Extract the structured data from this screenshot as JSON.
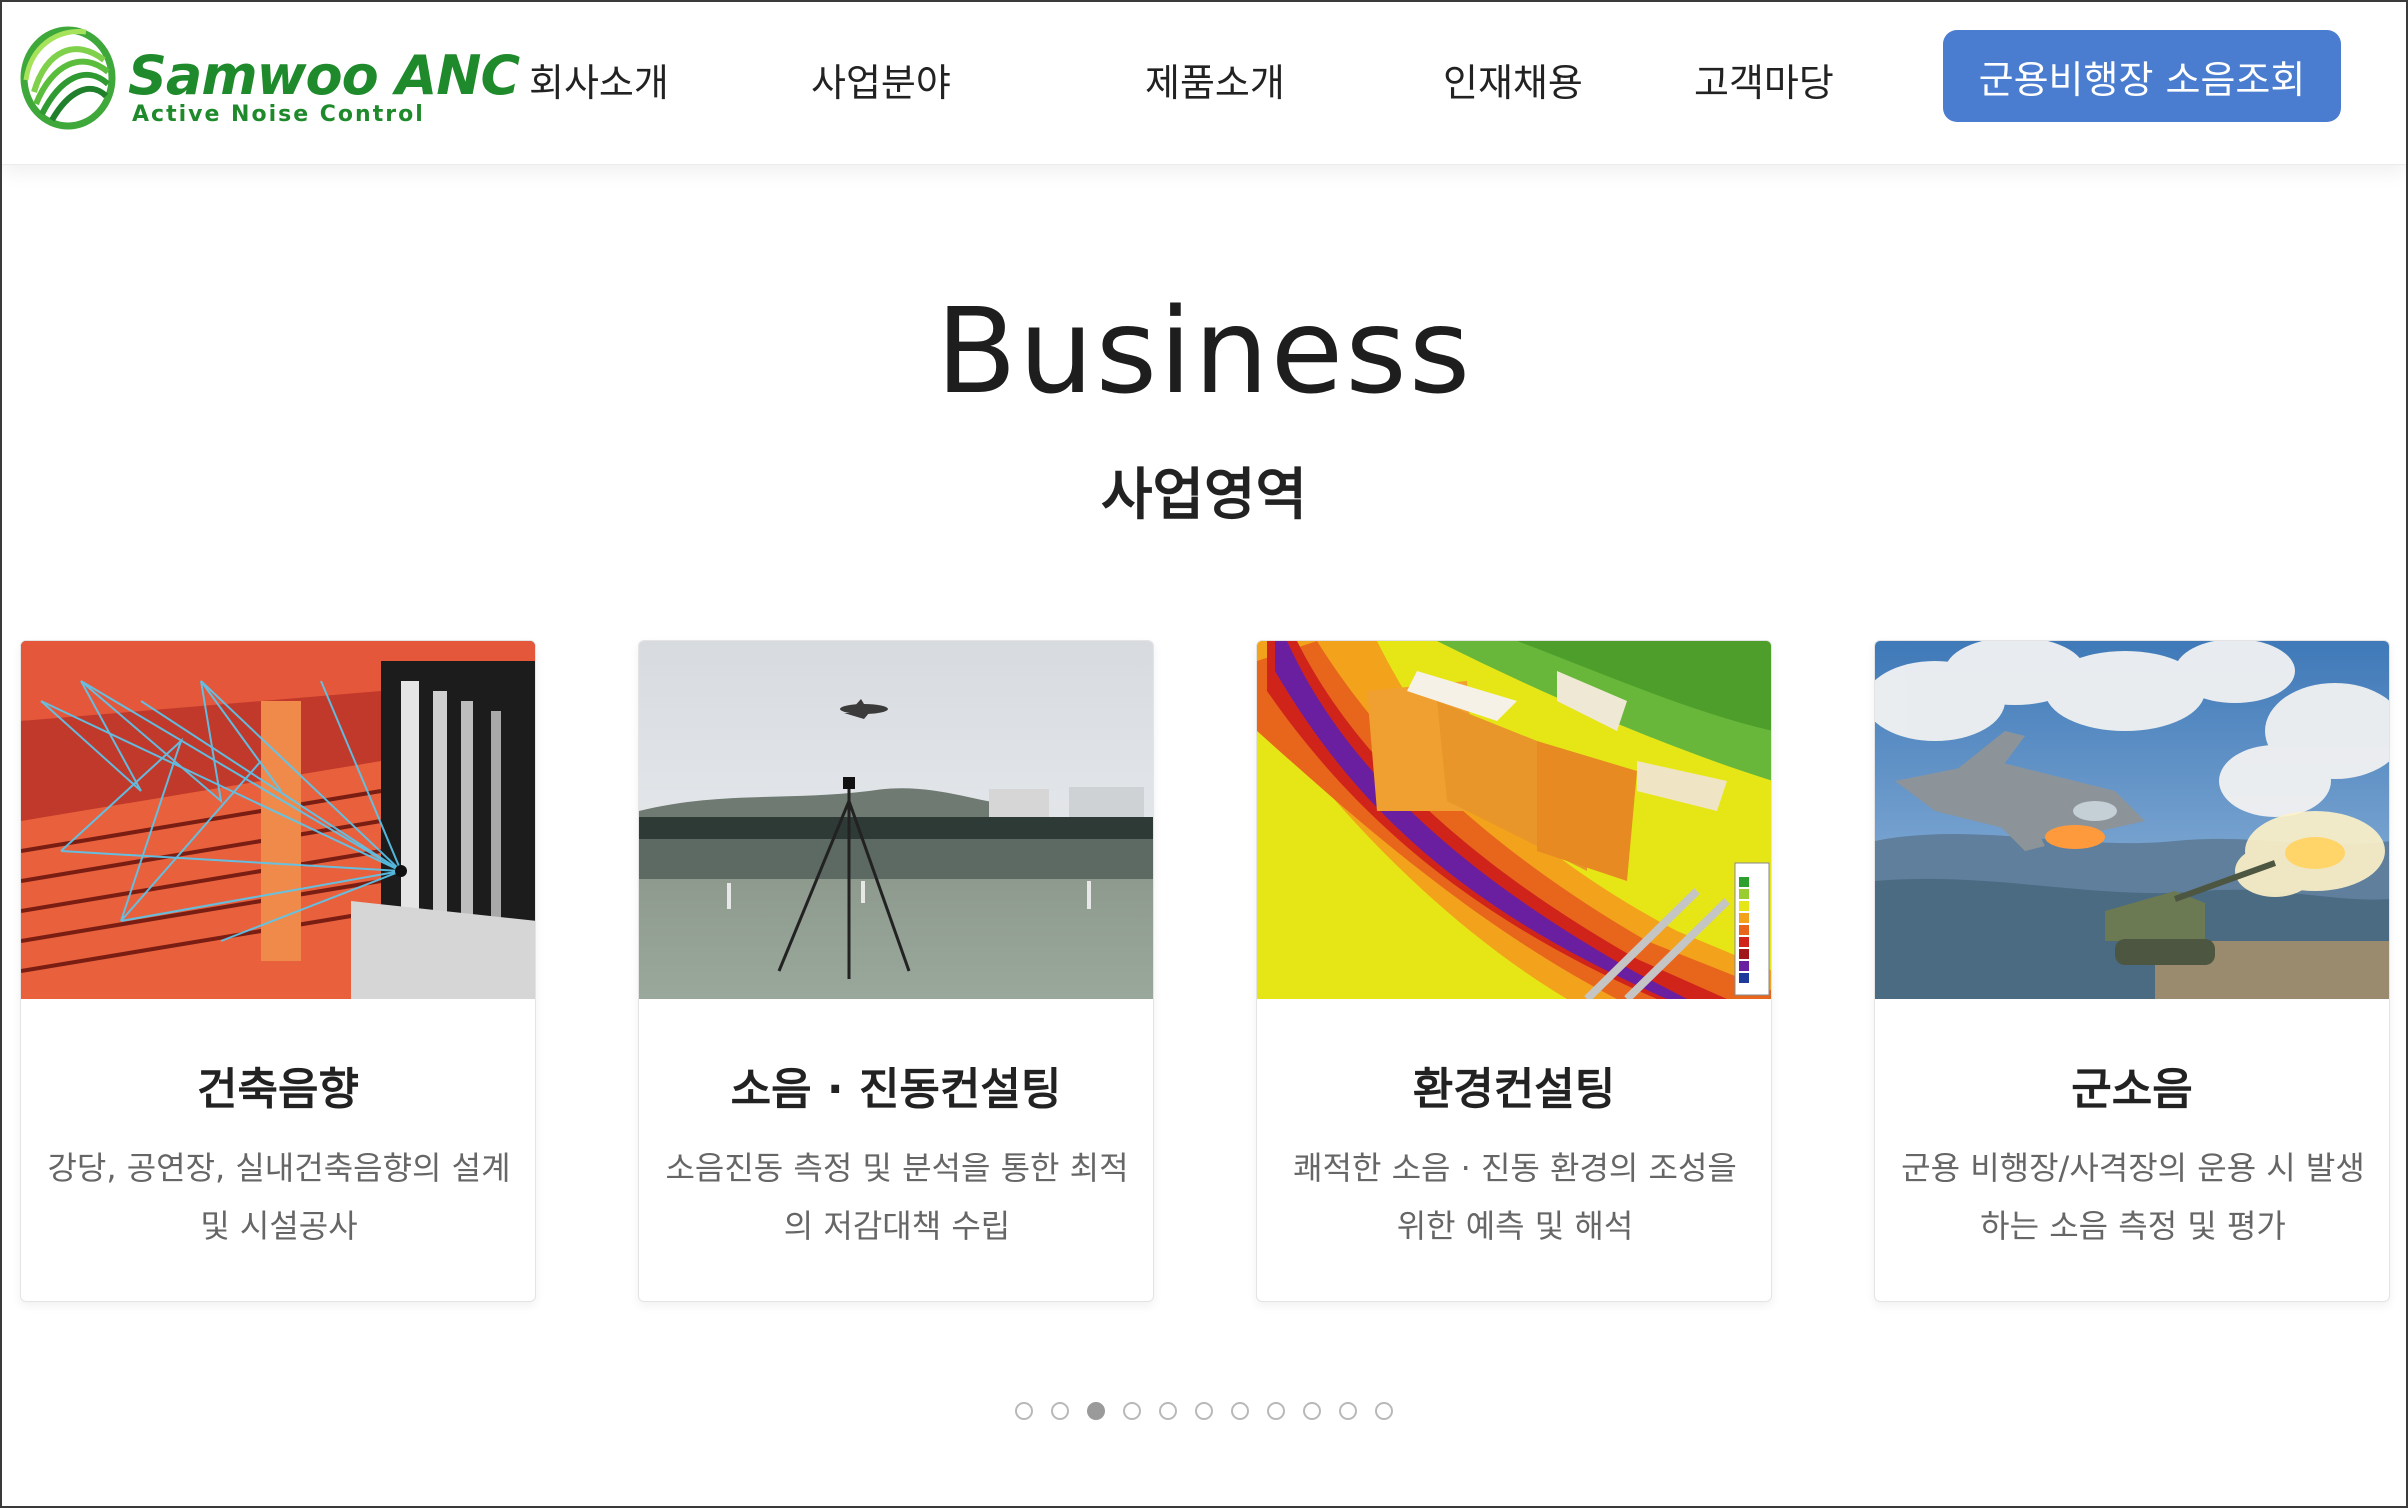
{
  "brand": {
    "name": "Samwoo ANC",
    "tagline": "Active Noise Control",
    "color": "#1f8a2b"
  },
  "nav": {
    "items": [
      {
        "label": "회사소개"
      },
      {
        "label": "사업분야"
      },
      {
        "label": "제품소개"
      },
      {
        "label": "인재채용"
      },
      {
        "label": "고객마당"
      }
    ],
    "cta_label": "군용비행장 소음조회",
    "cta_color": "#4a7ccf"
  },
  "section": {
    "title": "Business",
    "subtitle": "사업영역"
  },
  "cards": [
    {
      "title": "건축음향",
      "description": "강당, 공연장, 실내건축음향의 설계 및 시설공사",
      "image_icon": "auditorium-acoustics-illustration"
    },
    {
      "title": "소음 · 진동컨설팅",
      "description": "소음진동 측정 및 분석을 통한 최적의 저감대책 수립",
      "image_icon": "airport-noise-measurement-photo"
    },
    {
      "title": "환경컨설팅",
      "description": "쾌적한 소음 · 진동 환경의 조성을 위한 예측 및 해석",
      "image_icon": "noise-map-simulation-image"
    },
    {
      "title": "군소음",
      "description": "군용 비행장/사격장의 운용 시 발생하는 소음 측정 및 평가",
      "image_icon": "military-jet-artillery-photo"
    }
  ],
  "pagination": {
    "count": 11,
    "active_index": 2
  }
}
